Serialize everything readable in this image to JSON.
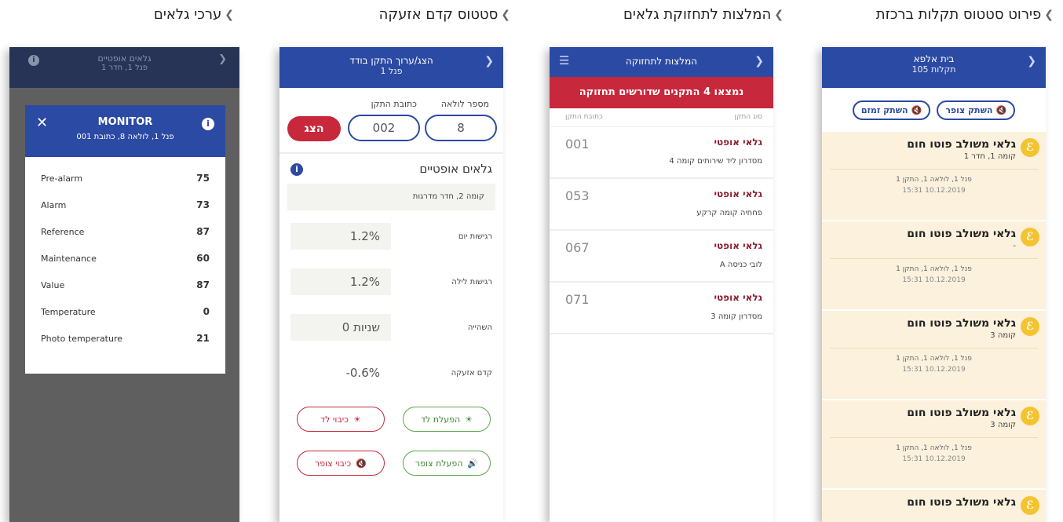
{
  "titles": [
    "פירוט סטטוס תקלות ברכזת",
    "המלצות לתחזוקת גלאים",
    "סטטוס קדם אזעקה",
    "ערכי גלאים"
  ],
  "panel1": {
    "header_title": "בית אלפא",
    "header_sub": "תקלות 105",
    "btn_mute_buzzer": "השתק צופר",
    "btn_mute_siren": "השתק זמזם",
    "cards": [
      {
        "title": "גלאי משולב פוטו חום",
        "sub": "קומה 1, חדר 1",
        "loc": "פנל 1, לולאה 1, התקן 1",
        "ts": "10.12.2019 15:31"
      },
      {
        "title": "גלאי משולב פוטו חום",
        "sub": "-",
        "loc": "פנל 1, לולאה 1, התקן 1",
        "ts": "10.12.2019 15:31"
      },
      {
        "title": "גלאי משולב פוטו חום",
        "sub": "קומה 3",
        "loc": "פנל 1, לולאה 1, התקן 1",
        "ts": "10.12.2019 15:31"
      },
      {
        "title": "גלאי משולב פוטו חום",
        "sub": "קומה 3",
        "loc": "פנל 1, לולאה 1, התקן 1",
        "ts": "10.12.2019 15:31"
      },
      {
        "title": "גלאי משולב פוטו חום",
        "sub": "",
        "loc": "",
        "ts": ""
      }
    ]
  },
  "panel2": {
    "header_title": "המלצות לתחזוקה",
    "banner": "נמצאו 4 התקנים שדורשים תחזוקה",
    "col_type": "סוג התקן",
    "col_addr": "כתובת התקן",
    "rows": [
      {
        "type": "גלאי אופטי",
        "addr": "001",
        "desc": "מסדרון ליד שירותים קומה 4"
      },
      {
        "type": "גלאי אופטי",
        "addr": "053",
        "desc": "פחחיה קומה קרקע"
      },
      {
        "type": "גלאי אופטי",
        "addr": "067",
        "desc": "לובי כניסה A"
      },
      {
        "type": "גלאי אופטי",
        "addr": "071",
        "desc": "מסדרון קומה 3"
      }
    ]
  },
  "panel3": {
    "header_title": "הצג/ערוך התקן בודד",
    "header_sub": "פנל 1",
    "lbl_loop": "מספר לולאה",
    "lbl_addr": "כתובת התקן",
    "loop_value": "8",
    "addr_value": "002",
    "show_btn": "הצג",
    "device_type": "גלאים אופטיים",
    "device_location": "קומה 2, חדר מדרגות",
    "rows": [
      {
        "label": "רגישות יום",
        "value": "1.2%"
      },
      {
        "label": "רגישות לילה",
        "value": "1.2%"
      },
      {
        "label": "השהייה",
        "value": "0 שניות"
      },
      {
        "label": "קדם אזעקה",
        "value": "-0.6%"
      }
    ],
    "btn_led_on": "הפעלת לד",
    "btn_led_off": "כיבוי לד",
    "btn_buzzer_on": "הפעלת צופר",
    "btn_buzzer_off": "כיבוי צופר"
  },
  "panel4": {
    "bg_header_title": "גלאים אופטיים",
    "bg_header_sub": "פנל 1, חדר 1",
    "modal_title": "MONITOR",
    "modal_sub": "פנל 1, לולאה 8, כתובת 001",
    "rows": [
      {
        "label": "Pre-alarm",
        "value": "75"
      },
      {
        "label": "Alarm",
        "value": "73"
      },
      {
        "label": "Reference",
        "value": "87"
      },
      {
        "label": "Maintenance",
        "value": "60"
      },
      {
        "label": "Value",
        "value": "87"
      },
      {
        "label": "Temperature",
        "value": "0"
      },
      {
        "label": "Photo temperature",
        "value": "21"
      }
    ]
  },
  "colors": {
    "primary": "#2b4aa3",
    "alarm_red": "#c8283b",
    "card_bg": "#fbf1dc",
    "green": "#5aa64a"
  }
}
